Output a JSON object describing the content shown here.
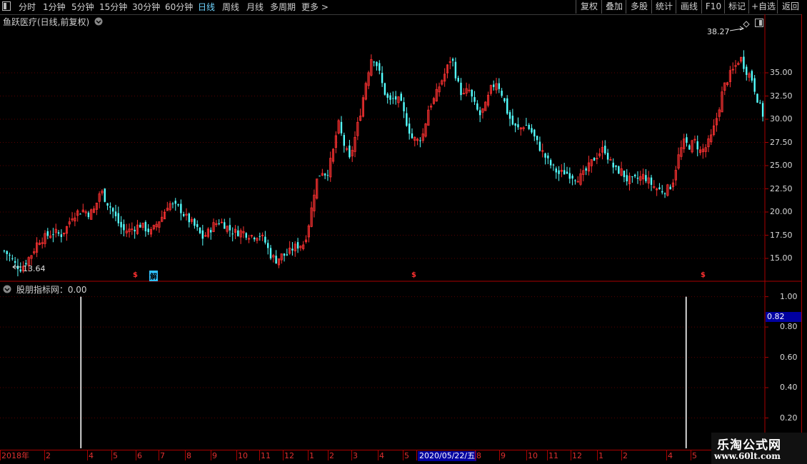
{
  "toolbar": {
    "periods": [
      "分时",
      "1分钟",
      "5分钟",
      "15分钟",
      "30分钟",
      "60分钟",
      "日线",
      "周线",
      "月线",
      "多周期",
      "更多 >"
    ],
    "active_period": "日线",
    "right_buttons": [
      "复权",
      "叠加",
      "多股",
      "统计",
      "画线",
      "F10",
      "标记",
      "+自选",
      "返回"
    ]
  },
  "main_chart": {
    "title": "鱼跃医疗(日线,前复权)",
    "price_ticks": [
      "35.00",
      "32.50",
      "30.00",
      "27.50",
      "25.00",
      "22.50",
      "20.00",
      "17.50",
      "15.00"
    ],
    "high_label": "38.27",
    "low_label": "13.64",
    "event_markers": [
      "$",
      "解",
      "$",
      "$"
    ]
  },
  "indicator": {
    "title": "股朋指标网：0.00",
    "ticks": [
      "1.00",
      "0.80",
      "0.60",
      "0.40",
      "0.20"
    ],
    "current_value_badge": "0.82"
  },
  "time_axis": {
    "labels": [
      "2018年",
      "2",
      "4",
      "5",
      "6",
      "7",
      "8",
      "9",
      "10",
      "11",
      "12",
      "1",
      "2",
      "3",
      "4",
      "5",
      "2020/05/22/五",
      "8",
      "9",
      "10",
      "11",
      "12",
      "1",
      "2",
      "4",
      "5"
    ]
  },
  "watermark": {
    "line1": "乐淘公式网",
    "line2": "www.60lt.com"
  },
  "colors": {
    "up": "#ff3232",
    "down": "#54ffff",
    "axis": "#aa0000",
    "grid": "#5a0000",
    "badge": "#0000a0"
  },
  "chart_data": {
    "type": "candlestick",
    "y_range": [
      13.0,
      39.0
    ],
    "indicator_range": [
      0,
      1.05
    ],
    "close_series": [
      15.8,
      15.2,
      14.3,
      13.9,
      14.8,
      15.6,
      16.9,
      17.2,
      17.6,
      17.8,
      17.5,
      18.3,
      19.6,
      20.0,
      20.2,
      19.8,
      20.3,
      22.4,
      21.2,
      20.3,
      19.0,
      18.0,
      18.0,
      18.3,
      18.6,
      18.2,
      17.8,
      18.8,
      19.6,
      21.0,
      20.6,
      20.4,
      19.5,
      18.9,
      18.2,
      17.2,
      17.8,
      18.6,
      19.0,
      18.6,
      18.0,
      17.8,
      17.9,
      17.6,
      17.4,
      17.6,
      16.9,
      15.4,
      14.8,
      15.3,
      15.4,
      16.1,
      16.4,
      16.6,
      19.3,
      23.1,
      24.5,
      24.0,
      26.2,
      29.6,
      27.3,
      25.6,
      28.1,
      31.0,
      34.4,
      37.0,
      35.6,
      33.2,
      31.8,
      32.3,
      31.8,
      29.8,
      28.0,
      27.7,
      28.4,
      31.3,
      32.2,
      33.8,
      35.1,
      36.8,
      34.1,
      32.4,
      33.3,
      31.6,
      30.4,
      31.4,
      33.3,
      34.1,
      32.6,
      30.5,
      29.2,
      28.9,
      29.5,
      28.8,
      27.6,
      26.5,
      25.5,
      24.7,
      24.1,
      24.3,
      24.0,
      23.7,
      23.8,
      24.6,
      25.6,
      26.3,
      26.9,
      25.4,
      24.5,
      24.4,
      23.5,
      23.4,
      23.6,
      23.9,
      23.2,
      22.6,
      22.3,
      22.4,
      23.0,
      25.8,
      27.5,
      27.1,
      27.6,
      26.5,
      27.0,
      28.2,
      30.5,
      33.3,
      34.6,
      35.5,
      36.7,
      35.3,
      34.5,
      32.3,
      30.5
    ],
    "indicator_spikes_at": [
      0.095,
      0.89
    ],
    "notes": [
      "high 38.27",
      "low 13.64"
    ]
  }
}
